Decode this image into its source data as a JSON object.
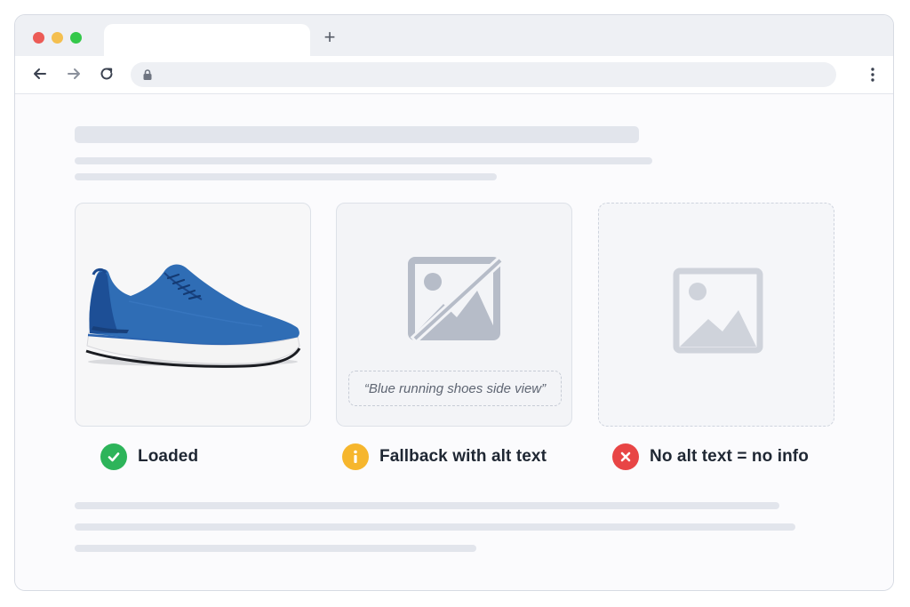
{
  "browser": {
    "new_tab_symbol": "+",
    "icons": {
      "back": "arrow-left-icon",
      "forward": "arrow-right-icon",
      "reload": "reload-icon",
      "lock": "lock-icon",
      "menu": "kebab-menu-icon"
    }
  },
  "cards": [
    {
      "state": "loaded",
      "image": "blue running shoe photo"
    },
    {
      "state": "fallback",
      "alt_text": "“Blue running shoes side view”",
      "icon": "broken-image-icon"
    },
    {
      "state": "empty",
      "icon": "image-placeholder-icon"
    }
  ],
  "statuses": [
    {
      "label": "Loaded",
      "icon": "check-icon",
      "color": "#2db45a"
    },
    {
      "label": "Fallback with alt text",
      "icon": "info-icon",
      "color": "#f6b62d"
    },
    {
      "label": "No alt text = no info",
      "icon": "x-icon",
      "color": "#e84545"
    }
  ],
  "colors": {
    "skeleton": "#e2e5ec",
    "placeholder_icon": "#b6bcc8",
    "shoe_blue": "#2f6db5"
  }
}
